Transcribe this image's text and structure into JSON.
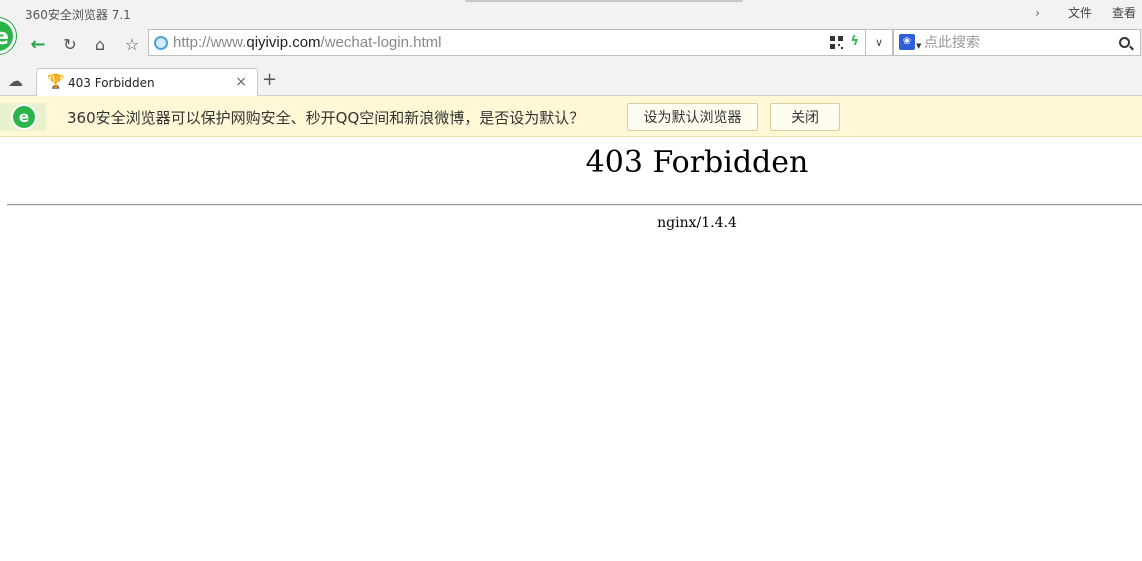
{
  "window": {
    "app_title": "360安全浏览器 7.1",
    "menu": {
      "file": "文件",
      "view": "查看"
    }
  },
  "nav": {
    "url_scheme": "http://www.",
    "url_host": "qiyivip.com",
    "url_path": "/wechat-login.html",
    "search_placeholder": "点此搜索"
  },
  "tabs": [
    {
      "title": "403 Forbidden",
      "active": true
    }
  ],
  "notification": {
    "message": "360安全浏览器可以保护网购安全、秒开QQ空间和新浪微博，是否设为默认？",
    "set_default_label": "设为默认浏览器",
    "close_label": "关闭"
  },
  "page": {
    "heading": "403 Forbidden",
    "server": "nginx/1.4.4"
  },
  "colors": {
    "brand_green": "#29b54a",
    "notify_bg": "#fef8d6",
    "chrome_bg": "#f2f2f2"
  }
}
